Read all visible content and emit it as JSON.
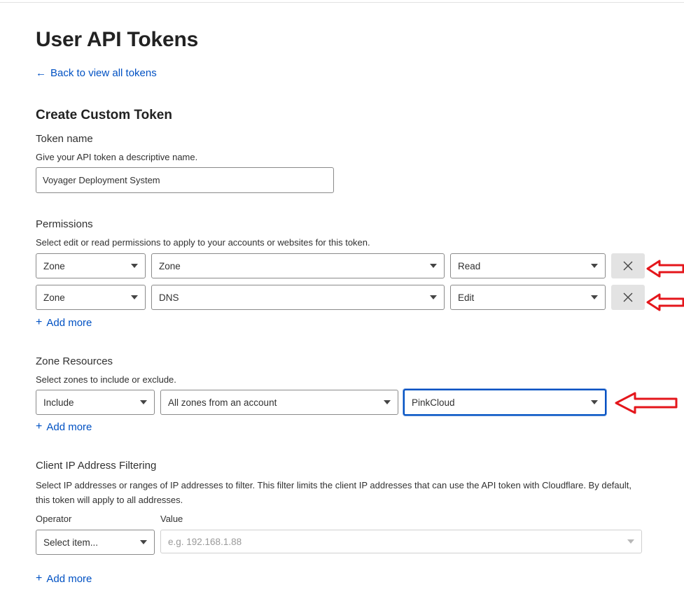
{
  "page": {
    "title": "User API Tokens",
    "back_link": "Back to view all tokens",
    "back_icon": "←",
    "section_title": "Create Custom Token"
  },
  "token_name": {
    "label": "Token name",
    "description": "Give your API token a descriptive name.",
    "value": "Voyager Deployment System"
  },
  "permissions": {
    "label": "Permissions",
    "description": "Select edit or read permissions to apply to your accounts or websites for this token.",
    "rows": [
      {
        "scope": "Zone",
        "resource": "Zone",
        "access": "Read"
      },
      {
        "scope": "Zone",
        "resource": "DNS",
        "access": "Edit"
      }
    ],
    "add_more": "Add more"
  },
  "zone_resources": {
    "label": "Zone Resources",
    "description": "Select zones to include or exclude.",
    "include": "Include",
    "type": "All zones from an account",
    "account": "PinkCloud",
    "add_more": "Add more"
  },
  "ip_filtering": {
    "label": "Client IP Address Filtering",
    "description": "Select IP addresses or ranges of IP addresses to filter. This filter limits the client IP addresses that can use the API token with Cloudflare. By default, this token will apply to all addresses.",
    "operator_label": "Operator",
    "value_label": "Value",
    "operator_value": "Select item...",
    "value_placeholder": "e.g. 192.168.1.88",
    "add_more": "Add more"
  },
  "icons": {
    "plus": "+",
    "close": "close-icon",
    "caret": "chevron-down-icon",
    "annotation": "red-arrow-icon"
  },
  "colors": {
    "link": "#0051c3",
    "focus": "#0051c3",
    "annotation": "#e4161b",
    "remove_bg": "#e3e3e3"
  }
}
